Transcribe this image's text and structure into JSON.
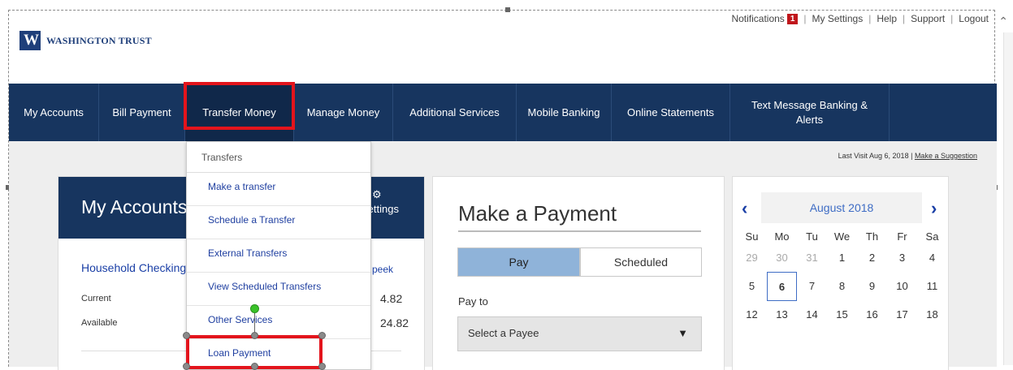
{
  "header": {
    "logo_mark": "W",
    "logo_text": "WASHINGTON TRUST",
    "top_links": [
      {
        "label": "Notifications"
      },
      {
        "label": "My Settings"
      },
      {
        "label": "Help"
      },
      {
        "label": "Support"
      },
      {
        "label": "Logout"
      }
    ],
    "notification_count": "1"
  },
  "nav": {
    "items": [
      {
        "label": "My Accounts"
      },
      {
        "label": "Bill Payment"
      },
      {
        "label": "Transfer Money"
      },
      {
        "label": "Manage Money"
      },
      {
        "label": "Additional Services"
      },
      {
        "label": "Mobile Banking"
      },
      {
        "label": "Online Statements"
      },
      {
        "label": "Text Message Banking & Alerts"
      }
    ],
    "active": "Transfer Money"
  },
  "dropdown": {
    "header": "Transfers",
    "items": [
      {
        "label": "Make a transfer"
      },
      {
        "label": "Schedule a Transfer"
      },
      {
        "label": "External Transfers"
      },
      {
        "label": "View Scheduled Transfers"
      },
      {
        "label": "Other Services"
      },
      {
        "label": "Loan Payment"
      }
    ]
  },
  "last_visit": {
    "text": "Last Visit Aug 6, 2018 |",
    "suggestion_link": "Make a Suggestion"
  },
  "accounts": {
    "title": "My Accounts",
    "settings_label": "Settings",
    "account_name": "Household Checking",
    "peek_link": "peek",
    "current_label": "Current",
    "current_value": "4.82",
    "available_label": "Available",
    "available_value": "24.82"
  },
  "payment": {
    "title": "Make a Payment",
    "tab_pay": "Pay",
    "tab_scheduled": "Scheduled",
    "pay_to_label": "Pay to",
    "payee_placeholder": "Select a Payee"
  },
  "calendar": {
    "month": "August 2018",
    "weekdays": [
      "Su",
      "Mo",
      "Tu",
      "We",
      "Th",
      "Fr",
      "Sa"
    ],
    "weeks": [
      [
        "29",
        "30",
        "31",
        "1",
        "2",
        "3",
        "4"
      ],
      [
        "5",
        "6",
        "7",
        "8",
        "9",
        "10",
        "11"
      ],
      [
        "12",
        "13",
        "14",
        "15",
        "16",
        "17",
        "18"
      ]
    ],
    "today": "6"
  },
  "colors": {
    "navy": "#17355f",
    "highlight": "#e3141c",
    "link": "#1a3fa6",
    "pay_tab": "#8fb3d9"
  }
}
